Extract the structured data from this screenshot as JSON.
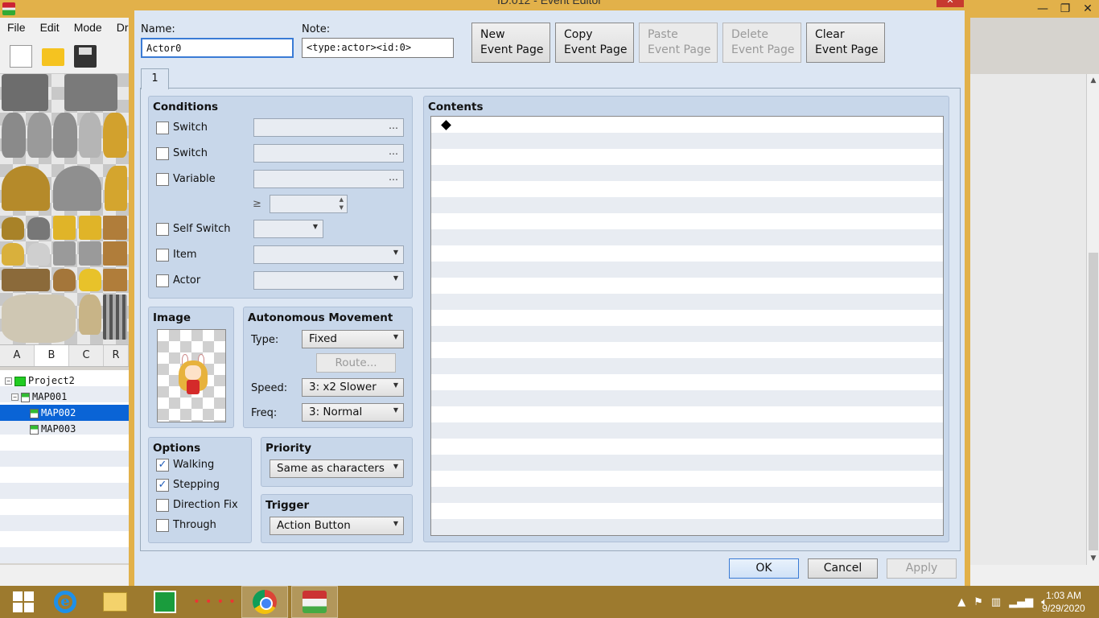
{
  "app": {
    "menu": [
      "File",
      "Edit",
      "Mode",
      "Dra"
    ],
    "tileset_tabs": [
      "A",
      "B",
      "C",
      "R"
    ],
    "tree": {
      "project": "Project2",
      "maps": [
        "MAP001",
        "MAP002",
        "MAP003"
      ],
      "selected": "MAP002"
    },
    "win_controls": [
      "—",
      "❐",
      "✕"
    ]
  },
  "dialog": {
    "title": "ID:012 - Event Editor",
    "close_label": "✕",
    "name_label": "Name:",
    "name_value": "Actor0",
    "note_label": "Note:",
    "note_value": "<type:actor><id:0>",
    "buttons": {
      "new_page": "New\nEvent Page",
      "copy_page": "Copy\nEvent Page",
      "paste_page": "Paste\nEvent Page",
      "delete_page": "Delete\nEvent Page",
      "clear_page": "Clear\nEvent Page"
    },
    "page_tab": "1",
    "conditions": {
      "title": "Conditions",
      "switch1": "Switch",
      "switch2": "Switch",
      "variable": "Variable",
      "gte": "≥",
      "self_switch": "Self Switch",
      "item": "Item",
      "actor": "Actor",
      "ellipsis": "…"
    },
    "image": {
      "title": "Image"
    },
    "movement": {
      "title": "Autonomous Movement",
      "type_label": "Type:",
      "type_value": "Fixed",
      "route_label": "Route...",
      "speed_label": "Speed:",
      "speed_value": "3: x2 Slower",
      "freq_label": "Freq:",
      "freq_value": "3: Normal"
    },
    "options": {
      "title": "Options",
      "walking": "Walking",
      "walking_checked": true,
      "stepping": "Stepping",
      "stepping_checked": true,
      "direction_fix": "Direction Fix",
      "direction_fix_checked": false,
      "through": "Through",
      "through_checked": false,
      "check_mark": "✓"
    },
    "priority": {
      "title": "Priority",
      "value": "Same as characters"
    },
    "trigger": {
      "title": "Trigger",
      "value": "Action Button"
    },
    "contents": {
      "title": "Contents"
    },
    "footer": {
      "ok": "OK",
      "cancel": "Cancel",
      "apply": "Apply"
    }
  },
  "taskbar": {
    "time": "1:03 AM",
    "date": "9/29/2020",
    "dots": "• • • •"
  },
  "colors": {
    "accent_gold": "#e2b14a",
    "dialog_bg": "#dce6f3",
    "group_bg": "#c8d7ea",
    "selection": "#0a64d6",
    "taskbar": "#9d7a2e"
  }
}
